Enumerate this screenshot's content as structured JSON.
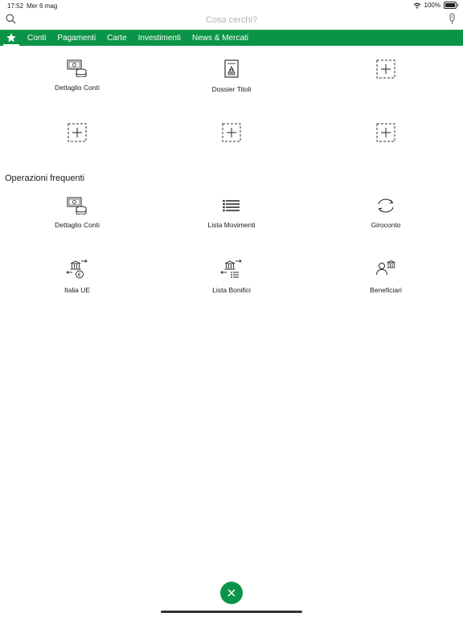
{
  "status_bar": {
    "time": "17:52",
    "date": "Mer 6 mag",
    "battery": "100%",
    "battery_level": 1.0
  },
  "search": {
    "placeholder": "Cosa cerchi?"
  },
  "nav": {
    "favorite_icon": "star-icon",
    "tabs": [
      {
        "label": "Conti"
      },
      {
        "label": "Pagamenti"
      },
      {
        "label": "Carte"
      },
      {
        "label": "Investimenti"
      },
      {
        "label": "News & Mercati"
      }
    ],
    "accent_color": "#0a9447"
  },
  "favorites": [
    {
      "label": "Dettaglio Conti",
      "icon": "money-coins-icon"
    },
    {
      "label": "Dossier Titoli",
      "icon": "dossier-document-icon"
    },
    {
      "label": "",
      "icon": "add-slot-icon"
    },
    {
      "label": "",
      "icon": "add-slot-icon"
    },
    {
      "label": "",
      "icon": "add-slot-icon"
    },
    {
      "label": "",
      "icon": "add-slot-icon"
    }
  ],
  "frequent": {
    "title": "Operazioni frequenti",
    "items": [
      {
        "label": "Dettaglio Conti",
        "icon": "money-coins-icon"
      },
      {
        "label": "Lista Movimenti",
        "icon": "list-icon"
      },
      {
        "label": "Giroconto",
        "icon": "transfer-cycle-icon"
      },
      {
        "label": "Italia UE",
        "icon": "bank-euro-transfer-icon"
      },
      {
        "label": "Lista Bonifici",
        "icon": "bank-list-transfer-icon"
      },
      {
        "label": "Beneficiari",
        "icon": "person-bank-icon"
      }
    ]
  },
  "close_button": {
    "icon": "close-icon"
  }
}
